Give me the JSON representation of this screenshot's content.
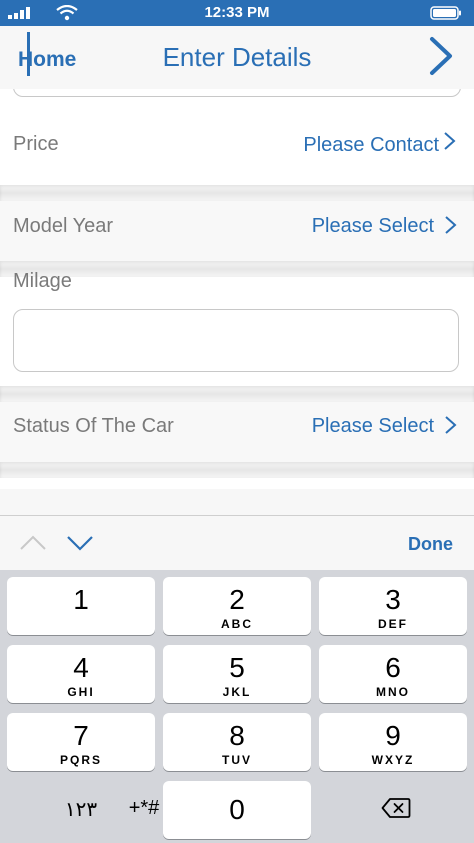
{
  "status_bar": {
    "time": "12:33 PM"
  },
  "nav": {
    "back_label": "Home",
    "title": "Enter Details"
  },
  "form": {
    "price": {
      "label": "Price",
      "value": "Please Contact"
    },
    "model_year": {
      "label": "Model Year",
      "value": "Please Select"
    },
    "milage": {
      "label": "Milage",
      "value": ""
    },
    "status": {
      "label": "Status Of The Car",
      "value": "Please Select"
    }
  },
  "keyboard": {
    "done_label": "Done",
    "keys": [
      {
        "num": "1",
        "letters": ""
      },
      {
        "num": "2",
        "letters": "ABC"
      },
      {
        "num": "3",
        "letters": "DEF"
      },
      {
        "num": "4",
        "letters": "GHI"
      },
      {
        "num": "5",
        "letters": "JKL"
      },
      {
        "num": "6",
        "letters": "MNO"
      },
      {
        "num": "7",
        "letters": "PQRS"
      },
      {
        "num": "8",
        "letters": "TUV"
      },
      {
        "num": "9",
        "letters": "WXYZ"
      },
      {
        "num": "0",
        "letters": ""
      }
    ],
    "arabic_label": "١٢٣",
    "symbols_label": "+*#"
  },
  "icons": {
    "status": [
      "signal-icon",
      "wifi-icon",
      "battery-icon"
    ],
    "nav": [
      "chevron-right-icon"
    ],
    "toolbar": [
      "chevron-up-icon",
      "chevron-down-icon"
    ],
    "keyboard": [
      "delete-icon"
    ]
  },
  "colors": {
    "accent": "#2a6fb5",
    "status_bar": "#2a6fb5",
    "label_gray": "#7a7a7a"
  }
}
